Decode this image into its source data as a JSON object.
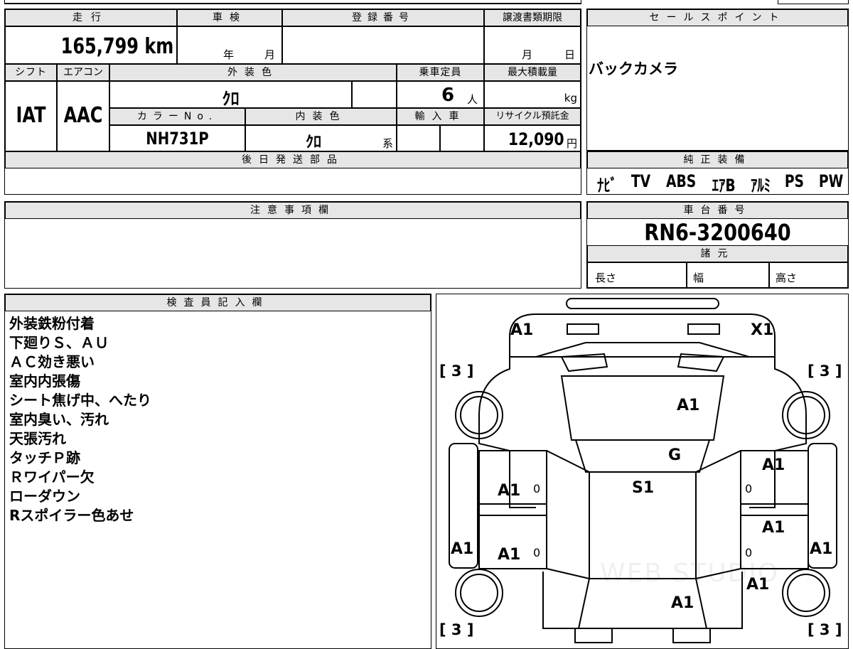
{
  "top_block": {
    "mileage_header": "走行",
    "mileage_value": "165,799 km",
    "shaken_header": "車検",
    "shaken_year": "年",
    "shaken_month": "月",
    "registration_header": "登録番号",
    "transfer_header": "譲渡書類期限",
    "transfer_month": "月",
    "transfer_day": "日",
    "shift_header": "シフト",
    "shift_value": "IAT",
    "aircon_header": "エアコン",
    "aircon_value": "AAC",
    "exterior_color_header": "外装色",
    "exterior_color_value": "ｸﾛ",
    "capacity_header": "乗車定員",
    "capacity_value": "6",
    "capacity_unit": "人",
    "max_load_header": "最大積載量",
    "max_load_unit": "kg",
    "color_no_header": "カラーNo.",
    "color_no_value": "NH731P",
    "interior_color_header": "内装色",
    "interior_color_value": "ｸﾛ",
    "interior_color_suffix": "系",
    "import_header": "輸入車",
    "recycle_header": "リサイクル預託金",
    "recycle_value": "12,090",
    "recycle_unit": "円",
    "later_parts_header": "後日発送部品"
  },
  "sales_point": {
    "header": "セールスポイント",
    "text": "バックカメラ"
  },
  "genuine_equipment": {
    "header": "純正装備",
    "items": [
      "ﾅﾋﾞ",
      "TV",
      "ABS",
      "ｴｱB",
      "ｱﾙﾐ",
      "PS",
      "PW"
    ]
  },
  "notes": {
    "header": "注意事項欄"
  },
  "chassis": {
    "header": "車台番号",
    "value": "RN6-3200640",
    "spec_header": "諸元",
    "length_label": "長さ",
    "width_label": "幅",
    "height_label": "高さ"
  },
  "inspector": {
    "header": "検査員記入欄",
    "lines": [
      "外装鉄粉付着",
      "下廻りＳ、ＡＵ",
      "ＡＣ効き悪い",
      "室内内張傷",
      "シート焦げ中、へたり",
      "室内臭い、汚れ",
      "天張汚れ",
      "タッチＰ跡",
      "Ｒワイパー欠",
      "ローダウン",
      "Rスポイラー色あせ"
    ]
  },
  "diagram": {
    "front_left": "A1",
    "front_right": "X1",
    "tire_fl": "[ 3 ]",
    "tire_fr": "[ 3 ]",
    "tire_rl": "[ 3 ]",
    "tire_rr": "[ 3 ]",
    "hood": "A1",
    "windshield": "G",
    "roof": "S1",
    "door_fl": "A1",
    "door_rl": "A1",
    "door_fr": "A1",
    "door_rr": "A1",
    "door_fl_small": "0",
    "door_rl_small": "0",
    "door_fr_small": "0",
    "door_rr_small": "0",
    "rocker_left": "A1",
    "rocker_right": "A1",
    "quarter_right": "A1",
    "rear": "A1",
    "watermark": "WEB STUDIO"
  }
}
